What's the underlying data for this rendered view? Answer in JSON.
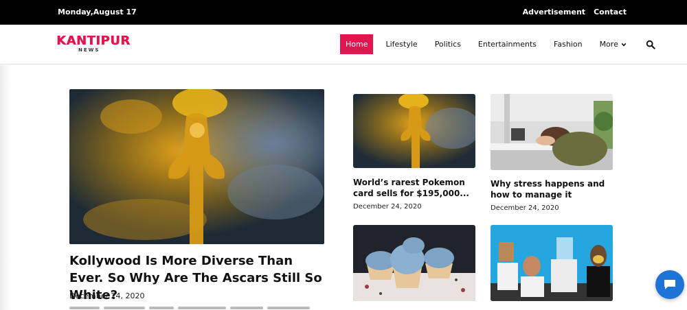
{
  "topbar": {
    "date": "Monday,August 17",
    "links": [
      "Advertisement",
      "Contact"
    ]
  },
  "logo": {
    "brand": "KANTIPUR",
    "sub": "NEWS"
  },
  "nav": {
    "items": [
      "Home",
      "Lifestyle",
      "Politics",
      "Entertainments",
      "Fashion",
      "More"
    ],
    "active": "Home",
    "more_icon": "chevron-down-icon",
    "search_icon": "search-icon"
  },
  "feature": {
    "title": "Kollywood Is More Diverse Than Ever. So Why Are The Ascars Still So White?",
    "date": "December 24, 2020",
    "image": "golden-statue-smoke"
  },
  "cards": [
    {
      "title": "World’s rarest Pokemon card sells for $195,000...",
      "date": "December 24, 2020",
      "image": "golden-statue-smoke"
    },
    {
      "title": "Why stress happens and how to manage it",
      "date": "December 24, 2020",
      "image": "person-asleep-at-desk"
    },
    {
      "title": "",
      "date": "",
      "image": "blue-cupcakes"
    },
    {
      "title": "",
      "date": "",
      "image": "people-with-masks"
    }
  ],
  "colors": {
    "accent": "#e0174f",
    "topbar": "#000000",
    "chat": "#1e73d6"
  },
  "chat_icon": "chat-bubble-icon"
}
